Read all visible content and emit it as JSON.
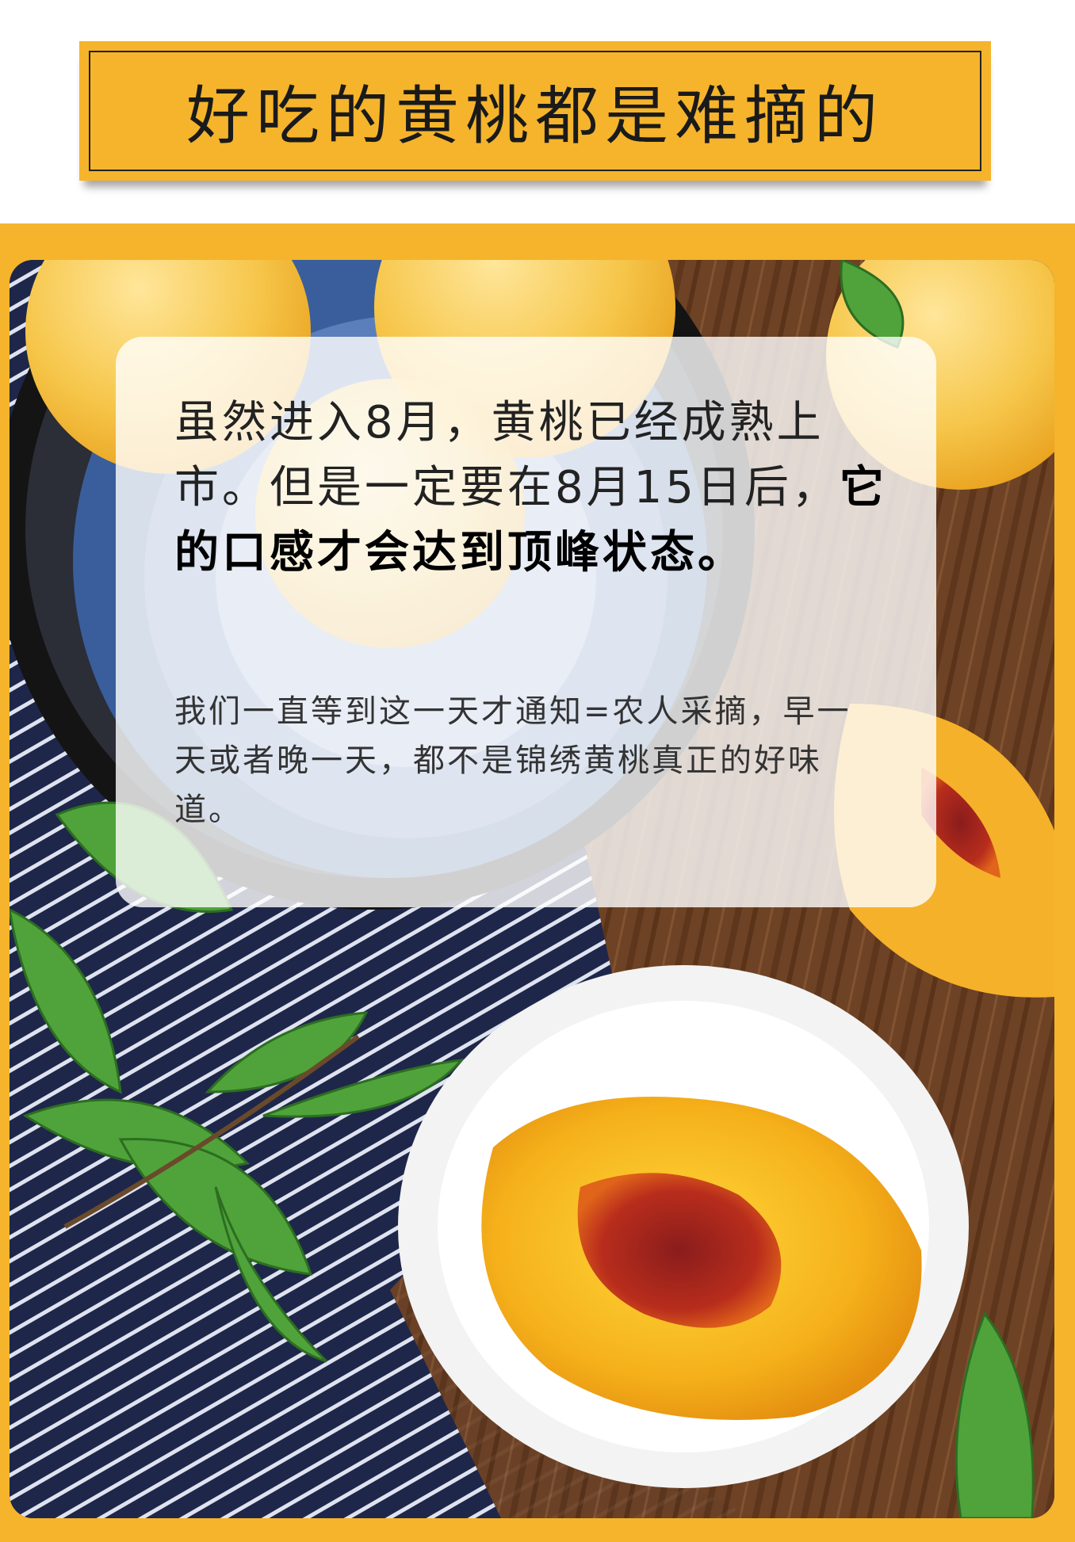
{
  "header": {
    "title_part1": "好吃的黄桃都是",
    "title_highlight": "难",
    "title_part2": "摘的"
  },
  "card": {
    "main_regular": "虽然进入8月，黄桃已经成熟上市。但是一定要在8月15日后，",
    "main_bold": "它的口感才会达到顶峰状态。",
    "sub_text": "我们一直等到这一天才通知=农人采摘，早一天或者晚一天，都不是锦绣黄桃真正的好味道。"
  },
  "colors": {
    "accent": "#f5b42b",
    "highlight_circle": "#f08a24",
    "text_dark": "#1a1a1a"
  }
}
